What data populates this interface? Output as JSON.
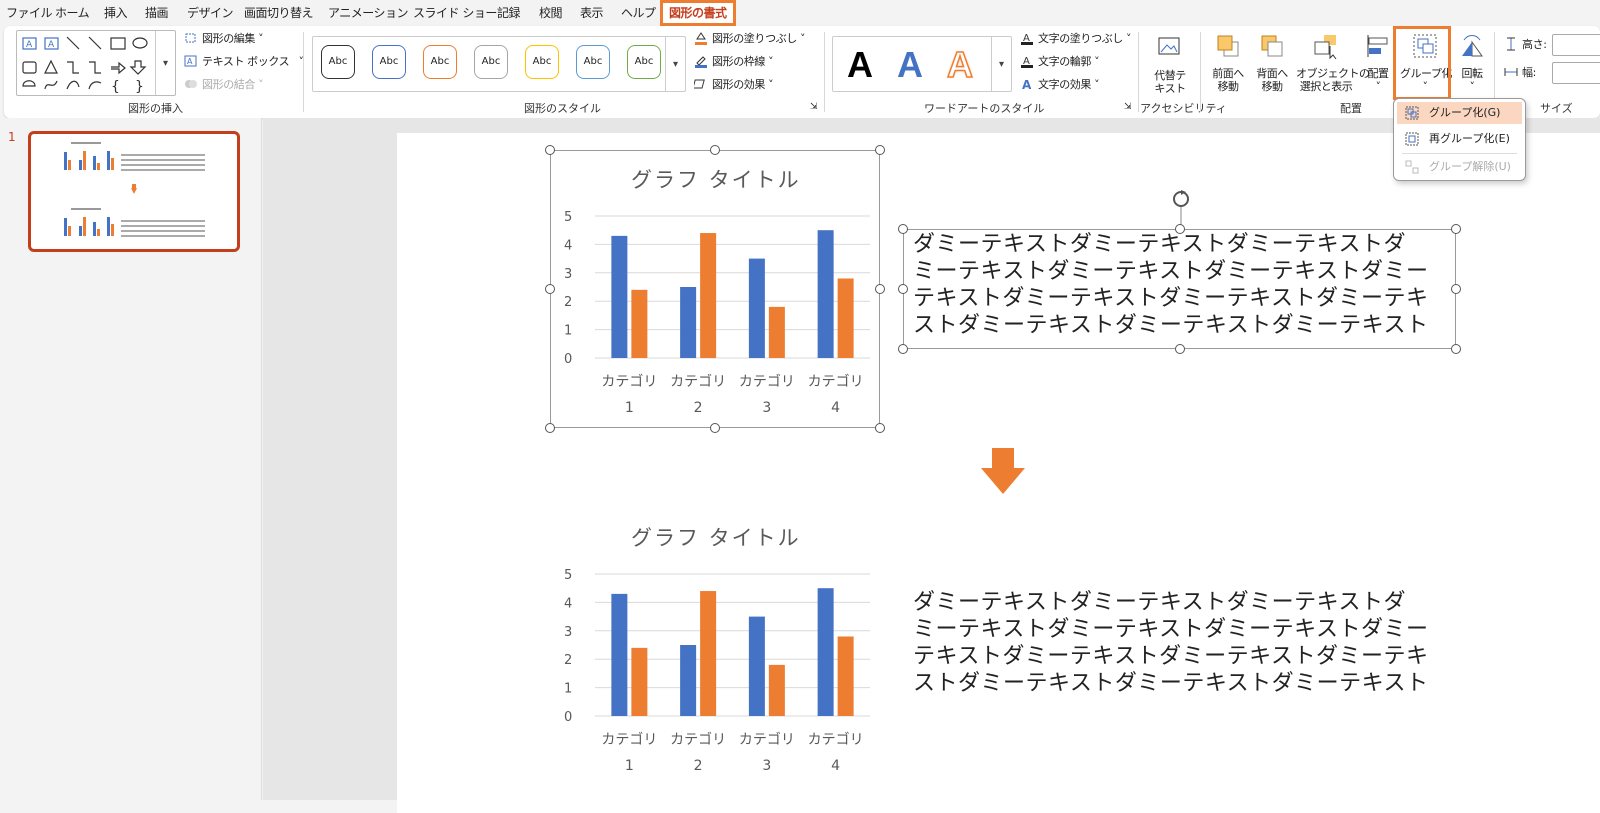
{
  "tabs": [
    "ファイル",
    "ホーム",
    "挿入",
    "描画",
    "デザイン",
    "画面切り替え",
    "アニメーション",
    "スライド ショー",
    "記録",
    "校閲",
    "表示",
    "ヘルプ",
    "図形の書式"
  ],
  "ribbon": {
    "insert_shapes": {
      "edit_shape": "図形の編集",
      "text_box": "テキスト ボックス",
      "merge_shapes": "図形の結合",
      "label": "図形の挿入"
    },
    "shape_styles": {
      "preset": "Abc",
      "preset_colors": [
        "#333333",
        "#4472c4",
        "#ed7d31",
        "#a5a5a5",
        "#ffc000",
        "#5b9bd5",
        "#70ad47"
      ],
      "fill": "図形の塗りつぶし",
      "outline": "図形の枠線",
      "effects": "図形の効果",
      "label": "図形のスタイル"
    },
    "wordart": {
      "glyph": "A",
      "text_fill": "文字の塗りつぶし",
      "text_outline": "文字の輪郭",
      "text_effects": "文字の効果",
      "label": "ワードアートのスタイル"
    },
    "accessibility": {
      "alt_text_line1": "代替テ",
      "alt_text_line2": "キスト",
      "label": "アクセシビリティ"
    },
    "arrange": {
      "bring_forward_1": "前面へ",
      "bring_forward_2": "移動",
      "send_backward_1": "背面へ",
      "send_backward_2": "移動",
      "selection_pane_1": "オブジェクトの",
      "selection_pane_2": "選択と表示",
      "align": "配置",
      "group": "グループ化",
      "rotate": "回転",
      "label": "配置"
    },
    "size": {
      "height_label": "高さ:",
      "width_label": "幅:",
      "label": "サイズ"
    }
  },
  "group_dropdown": {
    "items": [
      {
        "label": "グループ化(G)",
        "state": "highlighted"
      },
      {
        "label": "再グループ化(E)",
        "state": "normal"
      },
      {
        "label": "グループ解除(U)",
        "state": "disabled"
      }
    ]
  },
  "slide_panel": {
    "number": "1"
  },
  "slide": {
    "dummy_text_lines": [
      "ダミーテキストダミーテキストダミーテキストダ",
      "ミーテキストダミーテキストダミーテキストダミー",
      "テキストダミーテキストダミーテキストダミーテキ",
      "ストダミーテキストダミーテキストダミーテキスト"
    ]
  },
  "chart_data": [
    {
      "type": "bar",
      "title": "グラフ タイトル",
      "categories": [
        "カテゴリ 1",
        "カテゴリ 2",
        "カテゴリ 3",
        "カテゴリ 4"
      ],
      "series": [
        {
          "color": "#4472c4",
          "values": [
            4.3,
            2.5,
            3.5,
            4.5
          ]
        },
        {
          "color": "#ed7d31",
          "values": [
            2.4,
            4.4,
            1.8,
            2.8
          ]
        }
      ],
      "yticks": [
        "0",
        "1",
        "2",
        "3",
        "4",
        "5"
      ],
      "ylim": [
        0,
        5
      ],
      "grid": true
    },
    {
      "type": "bar",
      "title": "グラフ タイトル",
      "categories": [
        "カテゴリ 1",
        "カテゴリ 2",
        "カテゴリ 3",
        "カテゴリ 4"
      ],
      "series": [
        {
          "color": "#4472c4",
          "values": [
            4.3,
            2.5,
            3.5,
            4.5
          ]
        },
        {
          "color": "#ed7d31",
          "values": [
            2.4,
            4.4,
            1.8,
            2.8
          ]
        }
      ],
      "yticks": [
        "0",
        "1",
        "2",
        "3",
        "4",
        "5"
      ],
      "ylim": [
        0,
        5
      ],
      "grid": true
    }
  ],
  "colors": {
    "accent": "#ed7d31",
    "active_tab": "#c43e1c",
    "blue": "#4472c4"
  }
}
